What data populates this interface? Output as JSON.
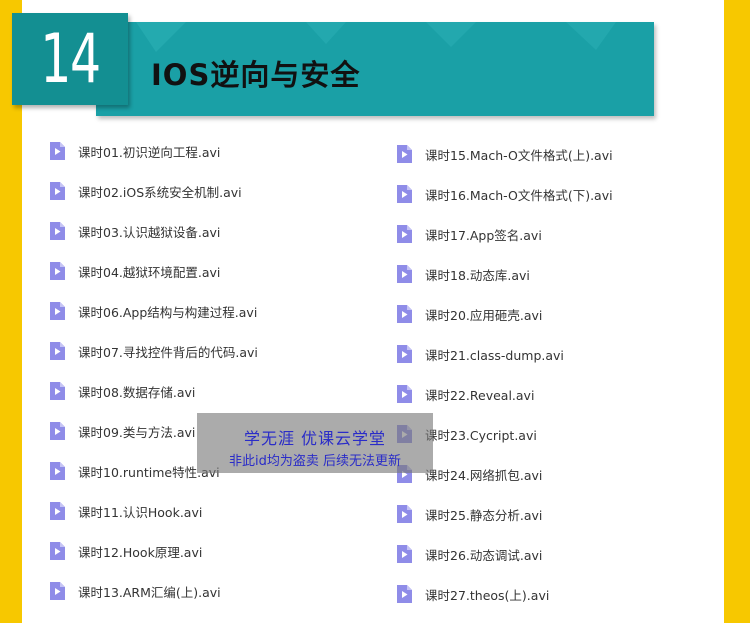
{
  "header": {
    "number": "14",
    "title": "IOS逆向与安全"
  },
  "icon": "video-file-icon",
  "colors": {
    "side_bar": "#f7c800",
    "banner": "#1aa0a6",
    "number_box": "#138f92",
    "file_icon": "#8f8ce8",
    "watermark_text": "#2a2cc8"
  },
  "left_column": [
    "课时01.初识逆向工程.avi",
    "课时02.iOS系统安全机制.avi",
    "课时03.认识越狱设备.avi",
    "课时04.越狱环境配置.avi",
    "课时06.App结构与构建过程.avi",
    "课时07.寻找控件背后的代码.avi",
    "课时08.数据存储.avi",
    "课时09.类与方法.avi",
    "课时10.runtime特性.avi",
    "课时11.认识Hook.avi",
    "课时12.Hook原理.avi",
    "课时13.ARM汇编(上).avi"
  ],
  "right_column": [
    "课时15.Mach-O文件格式(上).avi",
    "课时16.Mach-O文件格式(下).avi",
    "课时17.App签名.avi",
    "课时18.动态库.avi",
    "课时20.应用砸壳.avi",
    "课时21.class-dump.avi",
    "课时22.Reveal.avi",
    "课时23.Cycript.avi",
    "课时24.网络抓包.avi",
    "课时25.静态分析.avi",
    "课时26.动态调试.avi",
    "课时27.theos(上).avi"
  ],
  "watermark": {
    "line1": "学无涯  优课云学堂",
    "line2": "非此id均为盗卖  后续无法更新"
  }
}
